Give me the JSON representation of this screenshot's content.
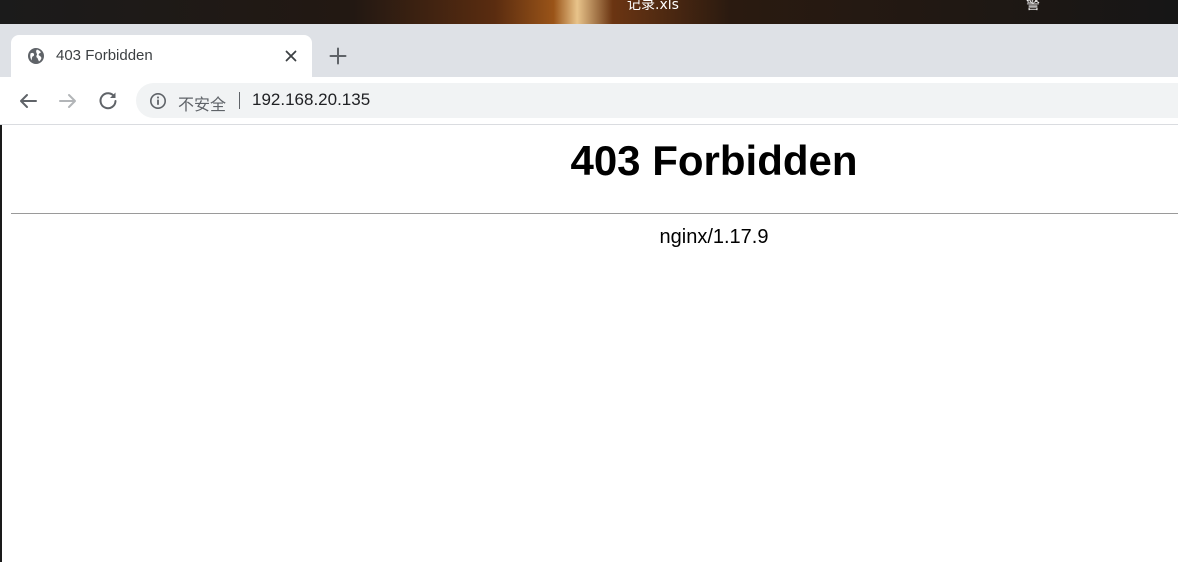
{
  "desktop": {
    "left_text": "记录.xls",
    "right_text": "警"
  },
  "browser": {
    "tab": {
      "title": "403 Forbidden",
      "icon": "globe-icon",
      "close_icon": "close-icon"
    },
    "new_tab_icon": "plus-icon",
    "nav": {
      "back_icon": "arrow-left-icon",
      "forward_icon": "arrow-right-icon",
      "reload_icon": "reload-icon"
    },
    "omnibox": {
      "info_icon": "info-icon",
      "security_label": "不安全",
      "url": "192.168.20.135"
    }
  },
  "page": {
    "heading": "403 Forbidden",
    "server": "nginx/1.17.9"
  },
  "colors": {
    "tabstrip": "#dee1e6",
    "omnibox": "#f1f3f4",
    "icon": "#5f6368"
  }
}
